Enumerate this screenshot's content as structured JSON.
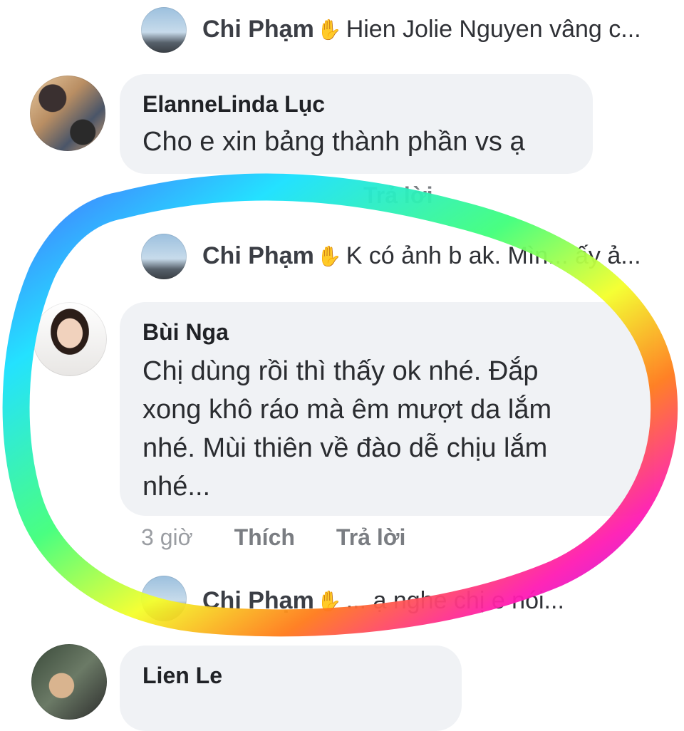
{
  "replies": [
    {
      "name": "Chi Phạm",
      "wave_icon": "wave-hand-icon",
      "preview": "Hien Jolie Nguyen vâng c..."
    },
    {
      "name": "Chi Phạm",
      "wave_icon": "wave-hand-icon",
      "preview": "K có ảnh b ak. Mìn... ấy ả..."
    },
    {
      "name": "Chi Phạm",
      "wave_icon": "wave-hand-icon",
      "preview": "... ạ nghe chị e nói..."
    }
  ],
  "comments": [
    {
      "author": "ElanneLinda Lục",
      "text": "Cho e xin bảng thành phần vs ạ",
      "actions": {
        "reply": "Trả lời"
      }
    },
    {
      "author": "Bùi Nga",
      "lines": [
        "Chị dùng rồi thì thấy ok nhé. Đắp",
        "xong khô ráo mà êm mượt da lắm",
        "nhé. Mùi thiên về đào dễ chịu lắm",
        "nhé..."
      ],
      "actions": {
        "time": "3 giờ",
        "like": "Thích",
        "reply": "Trả lời"
      }
    },
    {
      "author": "Lien Le"
    }
  ],
  "colors": {
    "bubble": "#f0f2f5",
    "marker_gradient": [
      "#3d6bff",
      "#18e0ff",
      "#40ff7a",
      "#f4ff2a",
      "#ff7a1a",
      "#ff1ab3",
      "#a020ff"
    ]
  }
}
